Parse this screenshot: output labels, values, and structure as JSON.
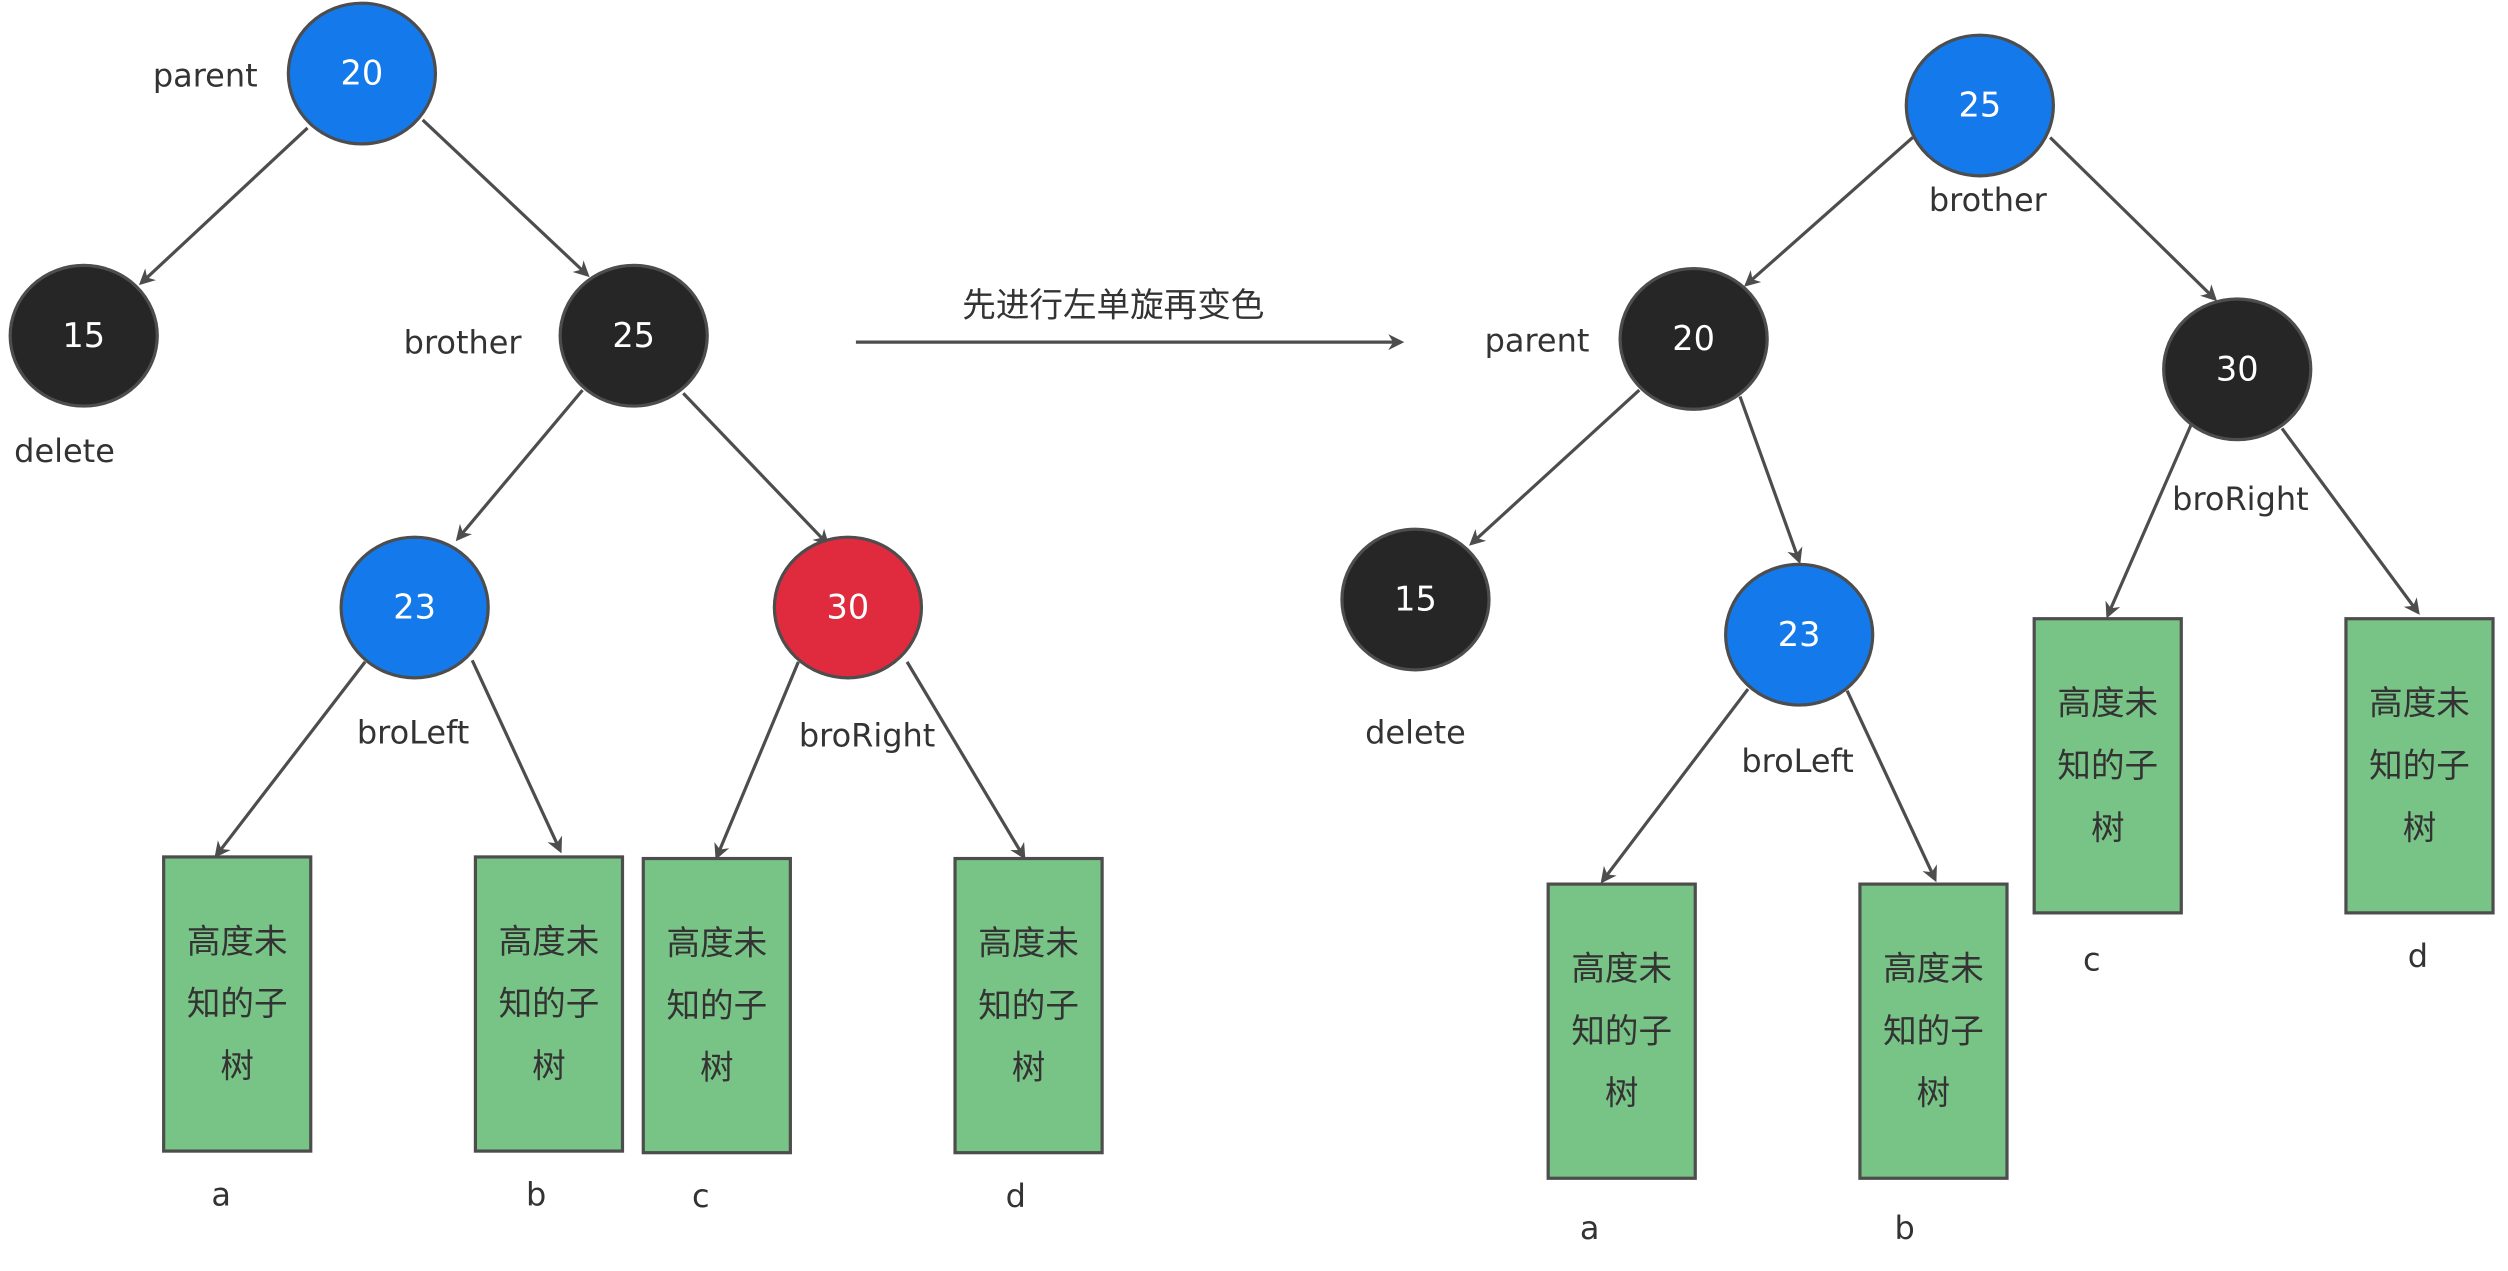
{
  "colors": {
    "red": "#e02a3e",
    "black": "#262626",
    "blue": "#1479ea",
    "subtree": "#78c386",
    "stroke": "#4d4d4d"
  },
  "caption": "先进行左单旋再变色",
  "subtree_text": [
    "高度未",
    "知的子",
    "树"
  ],
  "before": {
    "nodes": [
      {
        "id": "n20",
        "value": "20",
        "color": "blue",
        "label": "parent"
      },
      {
        "id": "n15",
        "value": "15",
        "color": "black",
        "label": "delete"
      },
      {
        "id": "n25",
        "value": "25",
        "color": "black",
        "label": "brother"
      },
      {
        "id": "n23",
        "value": "23",
        "color": "blue",
        "label": "broLeft"
      },
      {
        "id": "n30",
        "value": "30",
        "color": "red",
        "label": "broRight"
      }
    ],
    "subtrees": [
      "a",
      "b",
      "c",
      "d"
    ]
  },
  "after": {
    "nodes": [
      {
        "id": "m25",
        "value": "25",
        "color": "blue",
        "label": "brother"
      },
      {
        "id": "m20",
        "value": "20",
        "color": "black",
        "label": "parent"
      },
      {
        "id": "m30",
        "value": "30",
        "color": "black",
        "label": "broRight"
      },
      {
        "id": "m15",
        "value": "15",
        "color": "black",
        "label": "delete"
      },
      {
        "id": "m23",
        "value": "23",
        "color": "blue",
        "label": "broLeft"
      }
    ],
    "subtrees": [
      "a",
      "b",
      "c",
      "d"
    ]
  }
}
